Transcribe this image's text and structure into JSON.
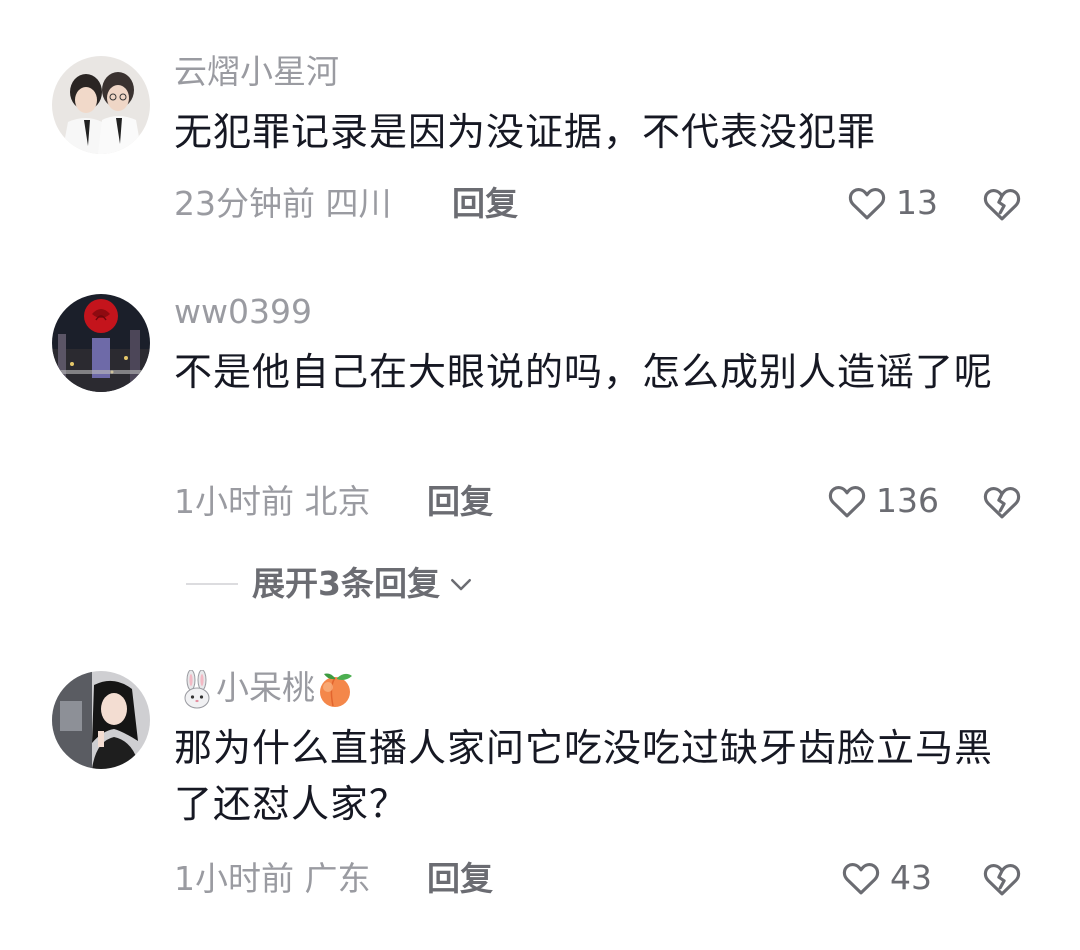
{
  "comments": [
    {
      "username": "云熠小星河",
      "text": "无犯罪记录是因为没证据，不代表没犯罪",
      "meta": "23分钟前 四川",
      "reply_label": "回复",
      "likes": "13"
    },
    {
      "username": "ww0399",
      "text": "不是他自己在大眼说的吗，怎么成别人造谣了呢",
      "meta": "1小时前 北京",
      "reply_label": "回复",
      "likes": "136",
      "expand_label": "展开3条回复"
    },
    {
      "username": "小呆桃",
      "username_icons": [
        "rabbit-icon",
        "peach-icon"
      ],
      "text": "那为什么直播人家问它吃没吃过缺牙齿脸立马黑了还怼人家？",
      "meta": "1小时前 广东",
      "reply_label": "回复",
      "likes": "43"
    }
  ],
  "colors": {
    "text_primary": "#161823",
    "text_secondary": "#9a9ba1",
    "action_text": "#6b6c72",
    "background": "#ffffff"
  }
}
